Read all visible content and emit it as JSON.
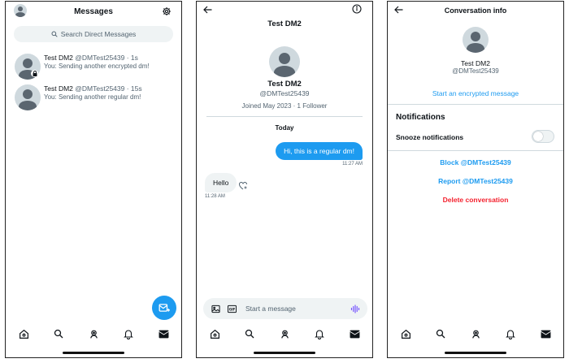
{
  "colors": {
    "accent": "#1d9bf0",
    "danger": "#f4212e",
    "text": "#0f1419",
    "muted": "#536471",
    "surface": "#eff3f4"
  },
  "inbox": {
    "title": "Messages",
    "search_placeholder": "Search Direct Messages",
    "conversations": [
      {
        "name": "Test DM2",
        "meta": "@DMTest25439 · 1s",
        "preview": "You: Sending another encrypted dm!",
        "encrypted": true
      },
      {
        "name": "Test DM2",
        "meta": "@DMTest25439 · 15s",
        "preview": "You: Sending another regular dm!",
        "encrypted": false
      }
    ]
  },
  "chat": {
    "title": "Test DM2",
    "profile_name": "Test DM2",
    "profile_handle": "@DMTest25439",
    "profile_meta": "Joined May 2023 · 1 Follower",
    "day_separator": "Today",
    "messages": [
      {
        "direction": "out",
        "text": "Hi, this is a regular dm!",
        "time": "11:27 AM"
      },
      {
        "direction": "in",
        "text": "Hello",
        "time": "11:28 AM"
      }
    ],
    "composer_placeholder": "Start a message"
  },
  "info": {
    "title": "Conversation info",
    "name": "Test DM2",
    "handle": "@DMTest25439",
    "start_encrypted_label": "Start an encrypted message",
    "notifications_heading": "Notifications",
    "snooze_label": "Snooze notifications",
    "snooze_enabled": false,
    "block_label": "Block @DMTest25439",
    "report_label": "Report @DMTest25439",
    "delete_label": "Delete conversation"
  },
  "tab_icons": [
    "home-icon",
    "search-icon",
    "communities-icon",
    "notifications-icon",
    "messages-icon"
  ]
}
